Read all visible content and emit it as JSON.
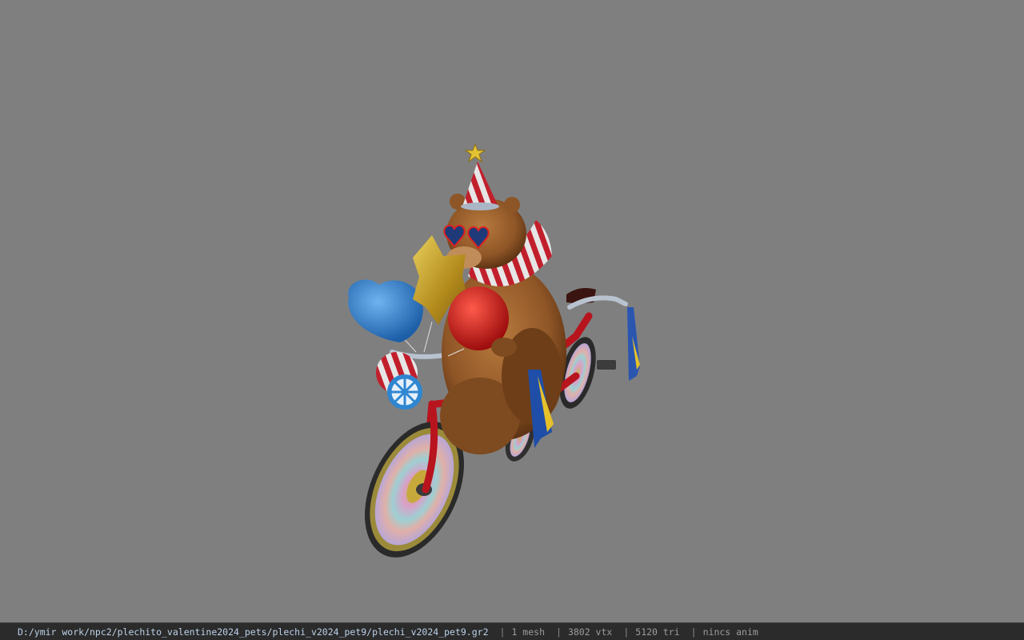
{
  "status_bar": {
    "file_path": "D:/ymir work/npc2/plechito_valentine2024_pets/plechi_v2024_pet9/plechi_v2024_pet9.gr2",
    "separator": "|",
    "mesh_count": "1 mesh",
    "vertex_count": "3802 vtx",
    "triangle_count": "5120 tri",
    "anim_status": "nincs anim"
  },
  "viewport": {
    "background_color": "#7f7f7f",
    "model": "bear-on-bicycle-with-balloons"
  }
}
